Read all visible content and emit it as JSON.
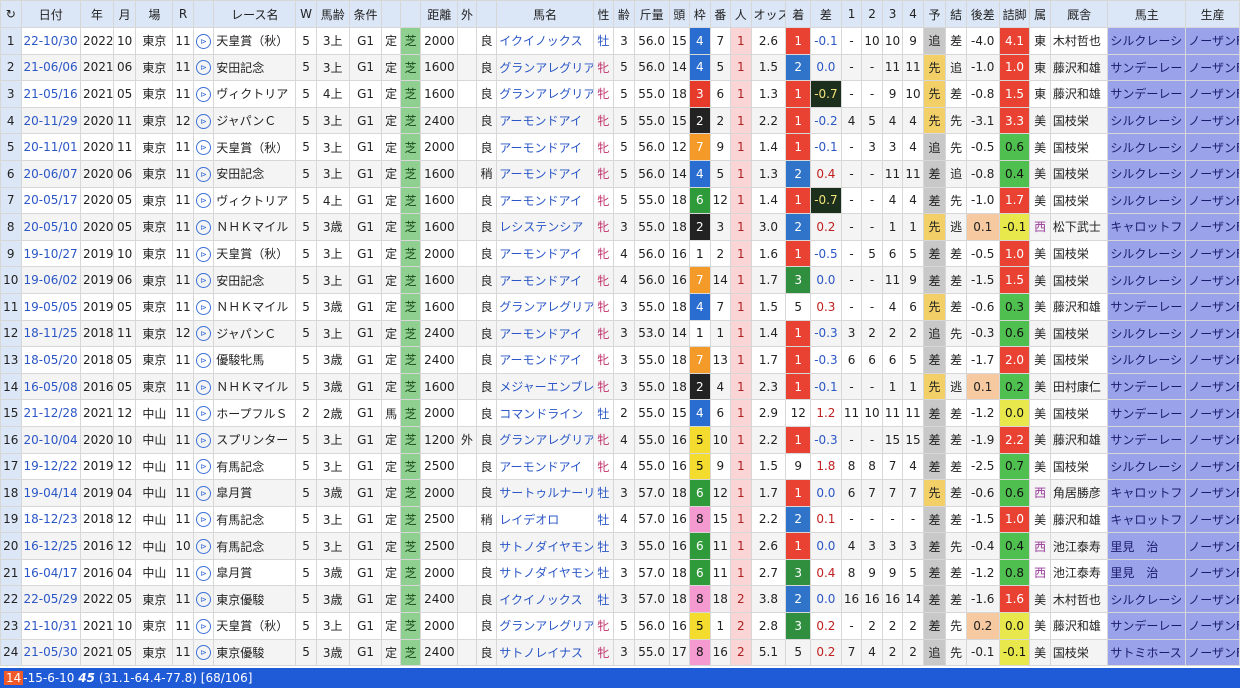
{
  "headers": [
    "↻",
    "日付",
    "年",
    "月",
    "場",
    "R",
    "",
    "レース名",
    "W",
    "馬齢",
    "条件",
    "",
    "",
    "距離",
    "外",
    "",
    "馬名",
    "性",
    "齢",
    "斤量",
    "頭",
    "枠",
    "番",
    "人",
    "オッズ",
    "着",
    "差",
    "1",
    "2",
    "3",
    "4",
    "予",
    "結",
    "後差",
    "詰脚",
    "属",
    "厩舎",
    "馬主",
    "生産"
  ],
  "rows": [
    [
      "1",
      "22-10/30",
      "2022",
      "10",
      "東京",
      "11",
      "⊳",
      "天皇賞（秋）",
      "5",
      "3上",
      "G1",
      "定",
      "芝",
      "2000",
      "",
      "良",
      "イクイノックス",
      "牡",
      "3",
      "56.0",
      "15",
      "4",
      "7",
      "1",
      "2.6",
      "1",
      "-0.1",
      "-",
      "10",
      "10",
      "9",
      "追",
      "差",
      "-4.0",
      "4.1",
      "東",
      "木村哲也",
      "シルクレーシ",
      "ノーザンF"
    ],
    [
      "2",
      "21-06/06",
      "2021",
      "06",
      "東京",
      "11",
      "⊳",
      "安田記念",
      "5",
      "3上",
      "G1",
      "定",
      "芝",
      "1600",
      "",
      "良",
      "グランアレグリア",
      "牝",
      "5",
      "56.0",
      "14",
      "4",
      "5",
      "1",
      "1.5",
      "2",
      "0.0",
      "-",
      "-",
      "11",
      "11",
      "先",
      "追",
      "-1.0",
      "1.0",
      "東",
      "藤沢和雄",
      "サンデーレー",
      "ノーザンF"
    ],
    [
      "3",
      "21-05/16",
      "2021",
      "05",
      "東京",
      "11",
      "⊳",
      "ヴィクトリア",
      "5",
      "4上",
      "G1",
      "定",
      "芝",
      "1600",
      "",
      "良",
      "グランアレグリア",
      "牝",
      "5",
      "55.0",
      "18",
      "3",
      "6",
      "1",
      "1.3",
      "1",
      "-0.7",
      "-",
      "-",
      "9",
      "10",
      "先",
      "差",
      "-0.8",
      "1.5",
      "東",
      "藤沢和雄",
      "サンデーレー",
      "ノーザンF"
    ],
    [
      "4",
      "20-11/29",
      "2020",
      "11",
      "東京",
      "12",
      "⊳",
      "ジャパンＣ",
      "5",
      "3上",
      "G1",
      "定",
      "芝",
      "2400",
      "",
      "良",
      "アーモンドアイ",
      "牝",
      "5",
      "55.0",
      "15",
      "2",
      "2",
      "1",
      "2.2",
      "1",
      "-0.2",
      "4",
      "5",
      "4",
      "4",
      "先",
      "先",
      "-3.1",
      "3.3",
      "美",
      "国枝栄",
      "シルクレーシ",
      "ノーザンF"
    ],
    [
      "5",
      "20-11/01",
      "2020",
      "11",
      "東京",
      "11",
      "⊳",
      "天皇賞（秋）",
      "5",
      "3上",
      "G1",
      "定",
      "芝",
      "2000",
      "",
      "良",
      "アーモンドアイ",
      "牝",
      "5",
      "56.0",
      "12",
      "7",
      "9",
      "1",
      "1.4",
      "1",
      "-0.1",
      "-",
      "3",
      "3",
      "4",
      "追",
      "先",
      "-0.5",
      "0.6",
      "美",
      "国枝栄",
      "シルクレーシ",
      "ノーザンF"
    ],
    [
      "6",
      "20-06/07",
      "2020",
      "06",
      "東京",
      "11",
      "⊳",
      "安田記念",
      "5",
      "3上",
      "G1",
      "定",
      "芝",
      "1600",
      "",
      "稍",
      "アーモンドアイ",
      "牝",
      "5",
      "56.0",
      "14",
      "4",
      "5",
      "1",
      "1.3",
      "2",
      "0.4",
      "-",
      "-",
      "11",
      "11",
      "差",
      "追",
      "-0.8",
      "0.4",
      "美",
      "国枝栄",
      "シルクレーシ",
      "ノーザンF"
    ],
    [
      "7",
      "20-05/17",
      "2020",
      "05",
      "東京",
      "11",
      "⊳",
      "ヴィクトリア",
      "5",
      "4上",
      "G1",
      "定",
      "芝",
      "1600",
      "",
      "良",
      "アーモンドアイ",
      "牝",
      "5",
      "55.0",
      "18",
      "6",
      "12",
      "1",
      "1.4",
      "1",
      "-0.7",
      "-",
      "-",
      "4",
      "4",
      "差",
      "先",
      "-1.0",
      "1.7",
      "美",
      "国枝栄",
      "シルクレーシ",
      "ノーザンF"
    ],
    [
      "8",
      "20-05/10",
      "2020",
      "05",
      "東京",
      "11",
      "⊳",
      "ＮＨＫマイル",
      "5",
      "3歳",
      "G1",
      "定",
      "芝",
      "1600",
      "",
      "良",
      "レシステンシア",
      "牝",
      "3",
      "55.0",
      "18",
      "2",
      "3",
      "1",
      "3.0",
      "2",
      "0.2",
      "-",
      "-",
      "1",
      "1",
      "先",
      "逃",
      "0.1",
      "-0.1",
      "西",
      "松下武士",
      "キャロットフ",
      "ノーザンF"
    ],
    [
      "9",
      "19-10/27",
      "2019",
      "10",
      "東京",
      "11",
      "⊳",
      "天皇賞（秋）",
      "5",
      "3上",
      "G1",
      "定",
      "芝",
      "2000",
      "",
      "良",
      "アーモンドアイ",
      "牝",
      "4",
      "56.0",
      "16",
      "1",
      "2",
      "1",
      "1.6",
      "1",
      "-0.5",
      "-",
      "5",
      "6",
      "5",
      "差",
      "差",
      "-0.5",
      "1.0",
      "美",
      "国枝栄",
      "シルクレーシ",
      "ノーザンF"
    ],
    [
      "10",
      "19-06/02",
      "2019",
      "06",
      "東京",
      "11",
      "⊳",
      "安田記念",
      "5",
      "3上",
      "G1",
      "定",
      "芝",
      "1600",
      "",
      "良",
      "アーモンドアイ",
      "牝",
      "4",
      "56.0",
      "16",
      "7",
      "14",
      "1",
      "1.7",
      "3",
      "0.0",
      "-",
      "-",
      "11",
      "9",
      "差",
      "差",
      "-1.5",
      "1.5",
      "美",
      "国枝栄",
      "シルクレーシ",
      "ノーザンF"
    ],
    [
      "11",
      "19-05/05",
      "2019",
      "05",
      "東京",
      "11",
      "⊳",
      "ＮＨＫマイル",
      "5",
      "3歳",
      "G1",
      "定",
      "芝",
      "1600",
      "",
      "良",
      "グランアレグリア",
      "牝",
      "3",
      "55.0",
      "18",
      "4",
      "7",
      "1",
      "1.5",
      "5",
      "0.3",
      "-",
      "-",
      "4",
      "6",
      "先",
      "差",
      "-0.6",
      "0.3",
      "美",
      "藤沢和雄",
      "サンデーレー",
      "ノーザンF"
    ],
    [
      "12",
      "18-11/25",
      "2018",
      "11",
      "東京",
      "12",
      "⊳",
      "ジャパンＣ",
      "5",
      "3上",
      "G1",
      "定",
      "芝",
      "2400",
      "",
      "良",
      "アーモンドアイ",
      "牝",
      "3",
      "53.0",
      "14",
      "1",
      "1",
      "1",
      "1.4",
      "1",
      "-0.3",
      "3",
      "2",
      "2",
      "2",
      "追",
      "先",
      "-0.3",
      "0.6",
      "美",
      "国枝栄",
      "シルクレーシ",
      "ノーザンF"
    ],
    [
      "13",
      "18-05/20",
      "2018",
      "05",
      "東京",
      "11",
      "⊳",
      "優駿牝馬",
      "5",
      "3歳",
      "G1",
      "定",
      "芝",
      "2400",
      "",
      "良",
      "アーモンドアイ",
      "牝",
      "3",
      "55.0",
      "18",
      "7",
      "13",
      "1",
      "1.7",
      "1",
      "-0.3",
      "6",
      "6",
      "6",
      "5",
      "差",
      "差",
      "-1.7",
      "2.0",
      "美",
      "国枝栄",
      "シルクレーシ",
      "ノーザンF"
    ],
    [
      "14",
      "16-05/08",
      "2016",
      "05",
      "東京",
      "11",
      "⊳",
      "ＮＨＫマイル",
      "5",
      "3歳",
      "G1",
      "定",
      "芝",
      "1600",
      "",
      "良",
      "メジャーエンブレム",
      "牝",
      "3",
      "55.0",
      "18",
      "2",
      "4",
      "1",
      "2.3",
      "1",
      "-0.1",
      "-",
      "-",
      "1",
      "1",
      "先",
      "逃",
      "0.1",
      "0.2",
      "美",
      "田村康仁",
      "サンデーレー",
      "ノーザンF"
    ],
    [
      "15",
      "21-12/28",
      "2021",
      "12",
      "中山",
      "11",
      "⊳",
      "ホープフルＳ",
      "2",
      "2歳",
      "G1",
      "馬",
      "芝",
      "2000",
      "",
      "良",
      "コマンドライン",
      "牡",
      "2",
      "55.0",
      "15",
      "4",
      "6",
      "1",
      "2.9",
      "12",
      "1.2",
      "11",
      "10",
      "11",
      "11",
      "差",
      "差",
      "-1.2",
      "0.0",
      "美",
      "国枝栄",
      "サンデーレー",
      "ノーザンF"
    ],
    [
      "16",
      "20-10/04",
      "2020",
      "10",
      "中山",
      "11",
      "⊳",
      "スプリンター",
      "5",
      "3上",
      "G1",
      "定",
      "芝",
      "1200",
      "外",
      "良",
      "グランアレグリア",
      "牝",
      "4",
      "55.0",
      "16",
      "5",
      "10",
      "1",
      "2.2",
      "1",
      "-0.3",
      "-",
      "-",
      "15",
      "15",
      "差",
      "差",
      "-1.9",
      "2.2",
      "美",
      "藤沢和雄",
      "サンデーレー",
      "ノーザンF"
    ],
    [
      "17",
      "19-12/22",
      "2019",
      "12",
      "中山",
      "11",
      "⊳",
      "有馬記念",
      "5",
      "3上",
      "G1",
      "定",
      "芝",
      "2500",
      "",
      "良",
      "アーモンドアイ",
      "牝",
      "4",
      "55.0",
      "16",
      "5",
      "9",
      "1",
      "1.5",
      "9",
      "1.8",
      "8",
      "8",
      "7",
      "4",
      "差",
      "差",
      "-2.5",
      "0.7",
      "美",
      "国枝栄",
      "シルクレーシ",
      "ノーザンF"
    ],
    [
      "18",
      "19-04/14",
      "2019",
      "04",
      "中山",
      "11",
      "⊳",
      "皐月賞",
      "5",
      "3歳",
      "G1",
      "定",
      "芝",
      "2000",
      "",
      "良",
      "サートゥルナーリア",
      "牡",
      "3",
      "57.0",
      "18",
      "6",
      "12",
      "1",
      "1.7",
      "1",
      "0.0",
      "6",
      "7",
      "7",
      "7",
      "先",
      "差",
      "-0.6",
      "0.6",
      "西",
      "角居勝彦",
      "キャロットフ",
      "ノーザンF"
    ],
    [
      "19",
      "18-12/23",
      "2018",
      "12",
      "中山",
      "11",
      "⊳",
      "有馬記念",
      "5",
      "3上",
      "G1",
      "定",
      "芝",
      "2500",
      "",
      "稍",
      "レイデオロ",
      "牡",
      "4",
      "57.0",
      "16",
      "8",
      "15",
      "1",
      "2.2",
      "2",
      "0.1",
      "-",
      "-",
      "-",
      "-",
      "差",
      "差",
      "-1.5",
      "1.0",
      "美",
      "藤沢和雄",
      "キャロットフ",
      "ノーザンF"
    ],
    [
      "20",
      "16-12/25",
      "2016",
      "12",
      "中山",
      "10",
      "⊳",
      "有馬記念",
      "5",
      "3上",
      "G1",
      "定",
      "芝",
      "2500",
      "",
      "良",
      "サトノダイヤモンド",
      "牡",
      "3",
      "55.0",
      "16",
      "6",
      "11",
      "1",
      "2.6",
      "1",
      "0.0",
      "4",
      "3",
      "3",
      "3",
      "差",
      "先",
      "-0.4",
      "0.4",
      "西",
      "池江泰寿",
      "里見　治",
      "ノーザンF"
    ],
    [
      "21",
      "16-04/17",
      "2016",
      "04",
      "中山",
      "11",
      "⊳",
      "皐月賞",
      "5",
      "3歳",
      "G1",
      "定",
      "芝",
      "2000",
      "",
      "良",
      "サトノダイヤモンド",
      "牡",
      "3",
      "57.0",
      "18",
      "6",
      "11",
      "1",
      "2.7",
      "3",
      "0.4",
      "8",
      "9",
      "9",
      "5",
      "差",
      "差",
      "-1.2",
      "0.8",
      "西",
      "池江泰寿",
      "里見　治",
      "ノーザンF"
    ],
    [
      "22",
      "22-05/29",
      "2022",
      "05",
      "東京",
      "11",
      "⊳",
      "東京優駿",
      "5",
      "3歳",
      "G1",
      "定",
      "芝",
      "2400",
      "",
      "良",
      "イクイノックス",
      "牡",
      "3",
      "57.0",
      "18",
      "8",
      "18",
      "2",
      "3.8",
      "2",
      "0.0",
      "16",
      "16",
      "16",
      "14",
      "差",
      "差",
      "-1.6",
      "1.6",
      "美",
      "木村哲也",
      "シルクレーシ",
      "ノーザンF"
    ],
    [
      "23",
      "21-10/31",
      "2021",
      "10",
      "東京",
      "11",
      "⊳",
      "天皇賞（秋）",
      "5",
      "3上",
      "G1",
      "定",
      "芝",
      "2000",
      "",
      "良",
      "グランアレグリア",
      "牝",
      "5",
      "56.0",
      "16",
      "5",
      "1",
      "2",
      "2.8",
      "3",
      "0.2",
      "-",
      "2",
      "2",
      "2",
      "差",
      "先",
      "0.2",
      "0.0",
      "美",
      "藤沢和雄",
      "サンデーレー",
      "ノーザンF"
    ],
    [
      "24",
      "21-05/30",
      "2021",
      "05",
      "東京",
      "11",
      "⊳",
      "東京優駿",
      "5",
      "3歳",
      "G1",
      "定",
      "芝",
      "2400",
      "",
      "良",
      "サトノレイナス",
      "牝",
      "3",
      "55.0",
      "17",
      "8",
      "16",
      "2",
      "5.1",
      "5",
      "0.2",
      "7",
      "4",
      "2",
      "2",
      "追",
      "先",
      "-0.1",
      "-0.1",
      "美",
      "国枝栄",
      "サトミホース",
      "ノーザンF"
    ]
  ],
  "status": {
    "tag": "14",
    "text1": "-15-6-10",
    "em": "45",
    "text2": "(31.1-64.4-77.8) [68/106]"
  }
}
